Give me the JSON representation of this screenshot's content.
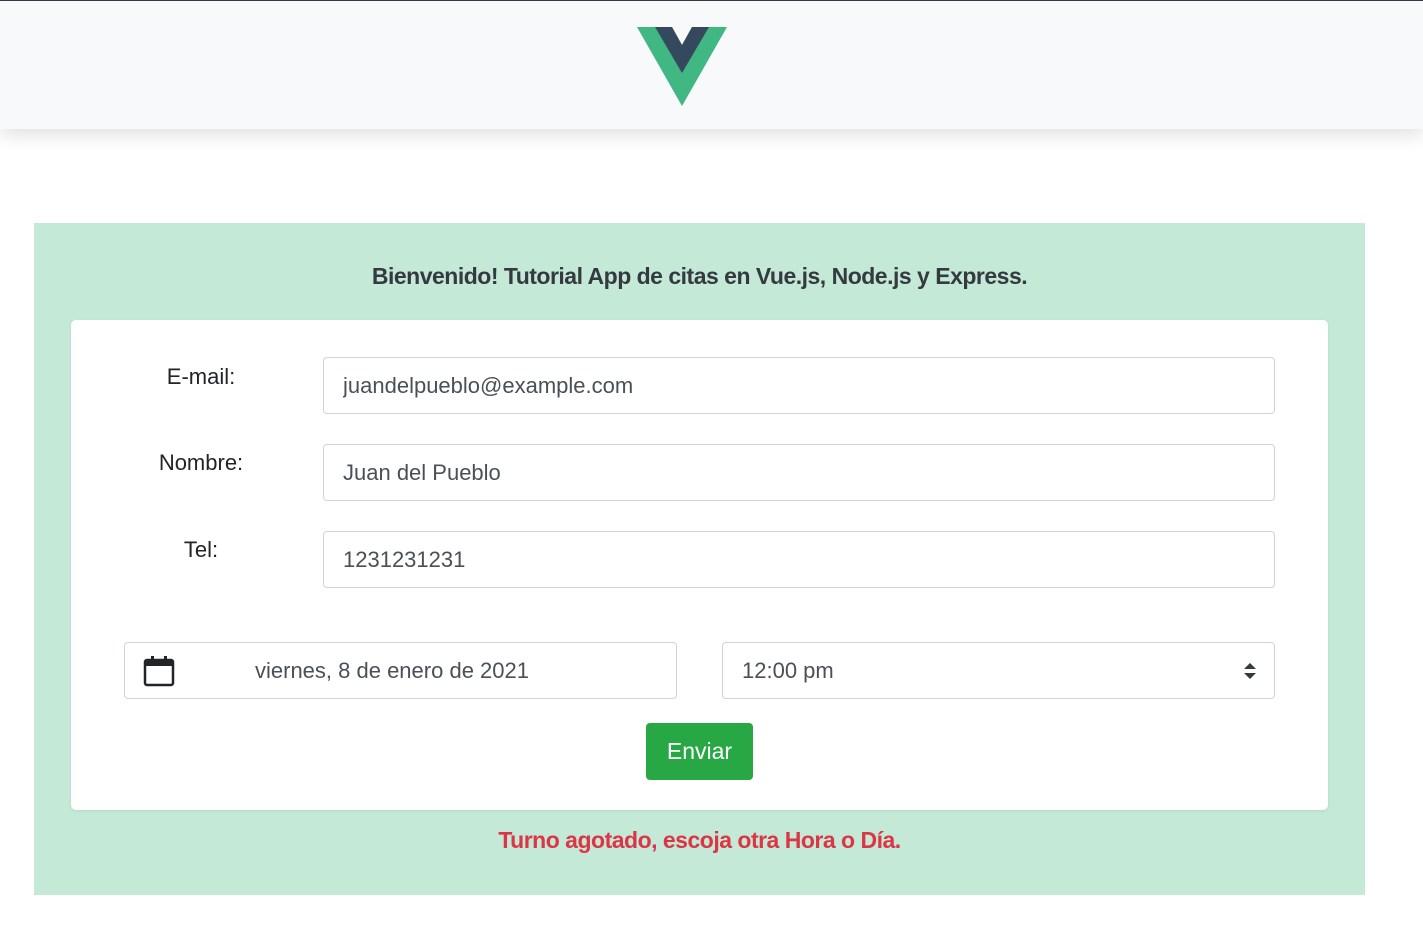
{
  "header": {
    "logo_icon": "vue-logo-icon",
    "logo_colors": {
      "outer": "#41b883",
      "inner": "#35495e"
    }
  },
  "panel": {
    "title": "Bienvenido! Tutorial App de citas en Vue.js, Node.js y Express.",
    "background": "#c4e9d7"
  },
  "form": {
    "email": {
      "label": "E-mail:",
      "value": "juandelpueblo@example.com"
    },
    "name": {
      "label": "Nombre:",
      "value": "Juan del Pueblo"
    },
    "phone": {
      "label": "Tel:",
      "value": "1231231231"
    },
    "date": {
      "value": "viernes, 8 de enero de 2021",
      "icon": "calendar-icon"
    },
    "time": {
      "value": "12:00 pm",
      "icon": "updown-arrows-icon"
    },
    "submit_label": "Enviar",
    "submit_color": "#28a745"
  },
  "status": {
    "error_message": "Turno agotado, escoja otra Hora o Día.",
    "error_color": "#dc3545"
  }
}
